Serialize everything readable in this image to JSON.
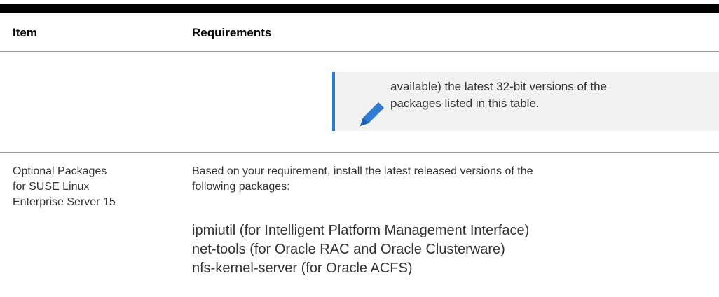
{
  "table": {
    "headers": {
      "item": "Item",
      "requirements": "Requirements"
    },
    "note": {
      "icon": "pencil-icon",
      "accent_color": "#2e7bcf",
      "lines": [
        "available) the latest 32-bit versions of the",
        "packages listed in this table."
      ]
    },
    "rows": [
      {
        "item_lines": [
          "Optional Packages",
          "for SUSE Linux",
          "Enterprise Server 15"
        ],
        "intro_lines": [
          "Based on your requirement, install the latest released versions of the",
          "following packages:"
        ],
        "packages": [
          "ipmiutil (for Intelligent Platform Management Interface)",
          "net-tools (for Oracle RAC and Oracle Clusterware)",
          "nfs-kernel-server (for Oracle ACFS)"
        ]
      }
    ]
  }
}
